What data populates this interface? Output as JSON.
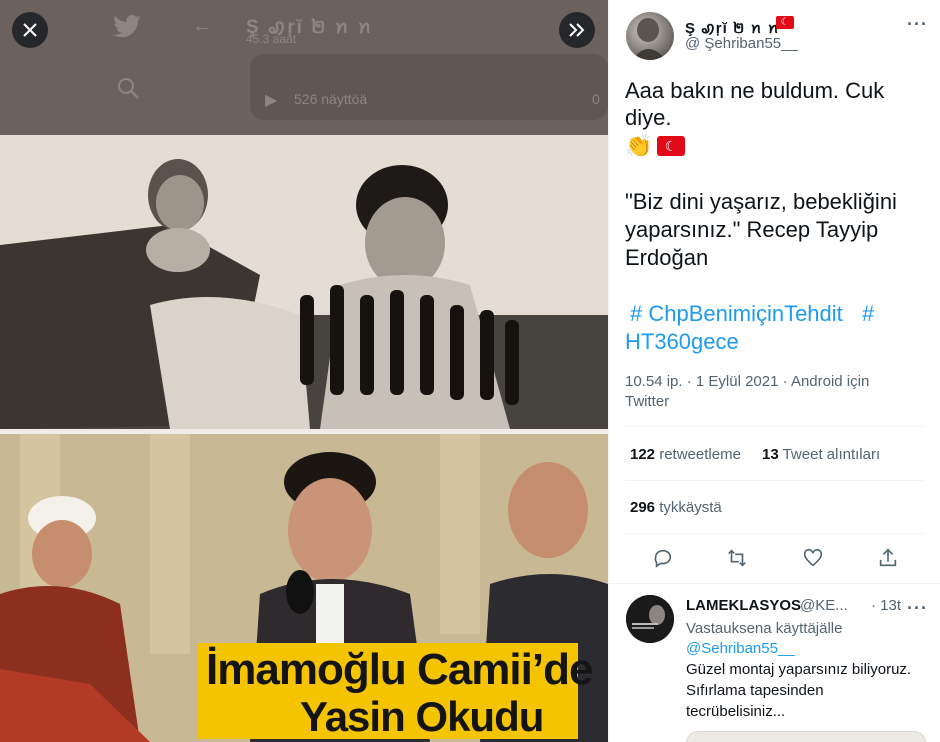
{
  "viewer": {
    "background_profile_name": "Ş ꩉŗĭ ២ ꪀ ꪀ",
    "background_time": "45.3 aaat",
    "background_views": "526 näyttöä",
    "background_views_right": "0",
    "caption_line1": "İmamoğlu Camii’de",
    "caption_line2": "Yasin Okudu",
    "close_icon": "close-icon",
    "next_icon": "double-chevron-right-icon"
  },
  "tweet": {
    "display_name": "Ş ꩉŗĭ ២ ꪀ ꪀ",
    "username": "@ Şehriban55__",
    "text_line1": "Aaa bakın ne buldum. Cuk",
    "text_line2": "diye.",
    "emoji_clap": "👏",
    "quote_line1": "\"Biz dini yaşarız, bebekliğini",
    "quote_line2": "yaparsınız.\" Recep Tayyip",
    "quote_line3": "Erdoğan",
    "hashtag_1": "# ChpBenimiçinTehdit",
    "hashtag_2": "#",
    "hashtag_2b": "HT360gece",
    "meta_line1": "10.54 ip. · 1 Eylül 2021  ·  Android için",
    "meta_line2": "Twitter",
    "retweets_count": "122",
    "retweets_label": "retweetleme",
    "quotes_count": "13",
    "quotes_label": "Tweet alıntıları",
    "likes_count": "296",
    "likes_label": "tykkäystä"
  },
  "reply": {
    "name": "LAMEKLASYOS",
    "handle": "@KE...",
    "time": "· 13t",
    "reply_to": "Vastauksena käyttäjälle",
    "reply_to_user": "@Sehriban55__",
    "text_line1": "Güzel montaj yaparsınız biliyoruz.",
    "text_line2": "Sıfırlama tapesinden",
    "text_line3": "tecrübelisiniz..."
  },
  "colors": {
    "accent": "#1d9bf0",
    "caption_band": "#f5c400",
    "muted": "#536471",
    "flag_red": "#e30a17"
  }
}
